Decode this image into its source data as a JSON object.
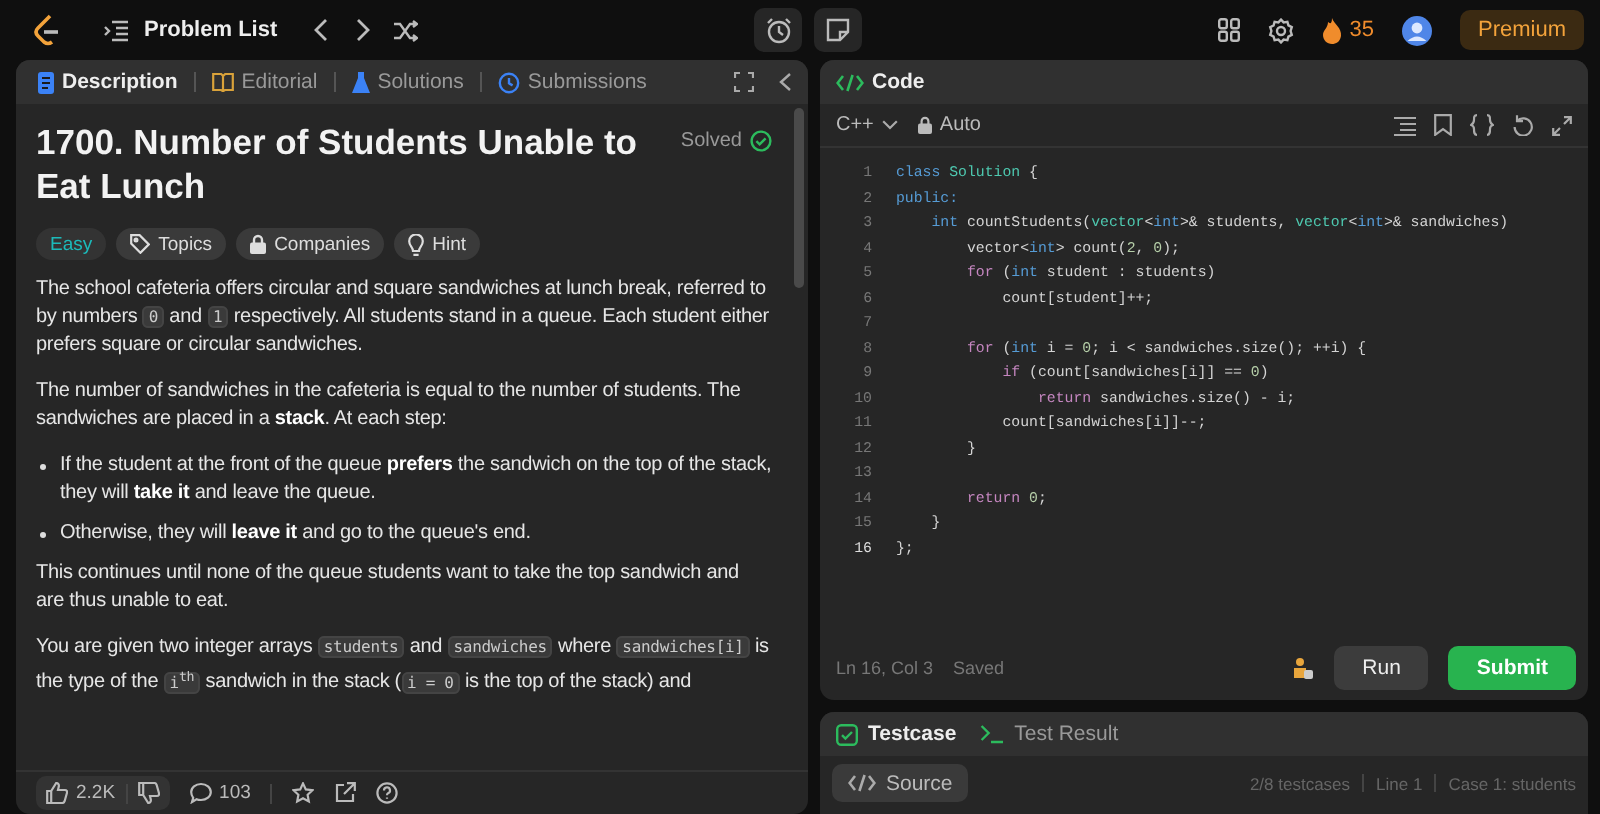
{
  "topbar": {
    "problem_list": "Problem List",
    "streak": "35",
    "premium": "Premium"
  },
  "description_panel": {
    "tabs": [
      {
        "label": "Description",
        "selected": true
      },
      {
        "label": "Editorial",
        "selected": false
      },
      {
        "label": "Solutions",
        "selected": false
      },
      {
        "label": "Submissions",
        "selected": false
      }
    ],
    "title": "1700. Number of Students Unable to Eat Lunch",
    "status": "Solved",
    "tags": [
      {
        "label": "Easy",
        "kind": "difficulty"
      },
      {
        "label": "Topics",
        "kind": "topics"
      },
      {
        "label": "Companies",
        "kind": "companies"
      },
      {
        "label": "Hint",
        "kind": "hint"
      }
    ],
    "blocks": [
      {
        "kind": "paragraph",
        "segments": [
          {
            "kind": "text",
            "text": "The school cafeteria offers circular and square sandwiches at lunch break, referred to by numbers "
          },
          {
            "kind": "code",
            "text": "0"
          },
          {
            "kind": "text",
            "text": " and "
          },
          {
            "kind": "code",
            "text": "1"
          },
          {
            "kind": "text",
            "text": " respectively. All students stand in a queue. Each student either prefers square or circular sandwiches."
          }
        ]
      },
      {
        "kind": "paragraph",
        "segments": [
          {
            "kind": "text",
            "text": "The number of sandwiches in the cafeteria is equal to the number of students. The sandwiches are placed in a **stack**. At each step:"
          }
        ]
      },
      {
        "kind": "bullet",
        "segments": [
          {
            "kind": "text",
            "text": "If the student at the front of the queue **prefers** the sandwich on the top of the stack, they will **take it** and leave the queue."
          }
        ]
      },
      {
        "kind": "bullet",
        "segments": [
          {
            "kind": "text",
            "text": "Otherwise, they will **leave it** and go to the queue's end."
          }
        ]
      },
      {
        "kind": "paragraph",
        "segments": [
          {
            "kind": "text",
            "text": "This continues until none of the queue students want to take the top sandwich and are thus unable to eat."
          }
        ]
      },
      {
        "kind": "paragraph",
        "segments": [
          {
            "kind": "text",
            "text": "You are given two integer arrays "
          },
          {
            "kind": "code",
            "text": "students"
          },
          {
            "kind": "text",
            "text": " and "
          },
          {
            "kind": "code",
            "text": "sandwiches"
          },
          {
            "kind": "text",
            "text": " where "
          },
          {
            "kind": "code",
            "text": "sandwiches[i]"
          },
          {
            "kind": "text",
            "text": " is the type of the "
          },
          {
            "kind": "code",
            "text": "i$^{th}$"
          },
          {
            "kind": "text",
            "text": " sandwich in the stack ("
          },
          {
            "kind": "code",
            "text": "i = 0"
          },
          {
            "kind": "text",
            "text": " is the top of the stack) and"
          }
        ]
      }
    ],
    "footer": {
      "likes": "2.2K",
      "comments": "103"
    }
  },
  "code_panel": {
    "title": "Code",
    "language": "C++",
    "mode": "Auto",
    "lines": [
      {
        "number": "1",
        "tokens": [
          {
            "kind": "kw",
            "text": "class"
          },
          {
            "kind": "type",
            "text": " Solution"
          },
          {
            "kind": "plain",
            "text": " {"
          }
        ]
      },
      {
        "number": "2",
        "tokens": [
          {
            "kind": "kw",
            "text": "public:"
          }
        ]
      },
      {
        "number": "3",
        "tokens": [
          {
            "kind": "kw",
            "text": "    int"
          },
          {
            "kind": "plain",
            "text": " countStudents("
          },
          {
            "kind": "type",
            "text": "vector"
          },
          {
            "kind": "plain",
            "text": "<"
          },
          {
            "kind": "kw",
            "text": "int"
          },
          {
            "kind": "plain",
            "text": ">& students, "
          },
          {
            "kind": "type",
            "text": "vector"
          },
          {
            "kind": "plain",
            "text": "<"
          },
          {
            "kind": "kw",
            "text": "int"
          },
          {
            "kind": "plain",
            "text": ">& sandwiches)"
          }
        ]
      },
      {
        "number": "4",
        "tokens": [
          {
            "kind": "plain",
            "text": "        vector<"
          },
          {
            "kind": "kw",
            "text": "int"
          },
          {
            "kind": "plain",
            "text": "> count("
          },
          {
            "kind": "num",
            "text": "2"
          },
          {
            "kind": "plain",
            "text": ", "
          },
          {
            "kind": "num",
            "text": "0"
          },
          {
            "kind": "plain",
            "text": ");"
          }
        ]
      },
      {
        "number": "5",
        "tokens": [
          {
            "kind": "ctrl",
            "text": "        for"
          },
          {
            "kind": "plain",
            "text": " ("
          },
          {
            "kind": "kw",
            "text": "int"
          },
          {
            "kind": "plain",
            "text": " student : students)"
          }
        ]
      },
      {
        "number": "6",
        "tokens": [
          {
            "kind": "plain",
            "text": "            count[student]++;"
          }
        ]
      },
      {
        "number": "7"
      },
      {
        "number": "8",
        "tokens": [
          {
            "kind": "ctrl",
            "text": "        for"
          },
          {
            "kind": "plain",
            "text": " ("
          },
          {
            "kind": "kw",
            "text": "int"
          },
          {
            "kind": "plain",
            "text": " i = "
          },
          {
            "kind": "num",
            "text": "0"
          },
          {
            "kind": "plain",
            "text": "; i < sandwiches.size(); ++i) {"
          }
        ]
      },
      {
        "number": "9",
        "tokens": [
          {
            "kind": "ctrl",
            "text": "            if"
          },
          {
            "kind": "plain",
            "text": " (count[sandwiches[i]] == "
          },
          {
            "kind": "num",
            "text": "0"
          },
          {
            "kind": "plain",
            "text": ")"
          }
        ]
      },
      {
        "number": "10",
        "tokens": [
          {
            "kind": "ctrl",
            "text": "                return"
          },
          {
            "kind": "plain",
            "text": " sandwiches.size() - i;"
          }
        ]
      },
      {
        "number": "11",
        "tokens": [
          {
            "kind": "plain",
            "text": "            count[sandwiches[i]]--;"
          }
        ]
      },
      {
        "number": "12",
        "tokens": [
          {
            "kind": "plain",
            "text": "        }"
          }
        ]
      },
      {
        "number": "13"
      },
      {
        "number": "14",
        "tokens": [
          {
            "kind": "ctrl",
            "text": "        return"
          },
          {
            "kind": "num",
            "text": " 0"
          },
          {
            "kind": "plain",
            "text": ";"
          }
        ]
      },
      {
        "number": "15",
        "tokens": [
          {
            "kind": "plain",
            "text": "    }"
          }
        ]
      },
      {
        "number": "16",
        "tokens": [
          {
            "kind": "plain",
            "text": "};"
          }
        ]
      }
    ],
    "cursor": "Ln 16, Col 3",
    "save_state": "Saved",
    "run": "Run",
    "submit": "Submit"
  },
  "test_panel": {
    "tabs": [
      {
        "label": "Testcase",
        "selected": true
      },
      {
        "label": "Test Result",
        "selected": false
      }
    ],
    "source": "Source",
    "info": [
      "2/8 testcases",
      "Line 1",
      "Case 1: students"
    ]
  }
}
